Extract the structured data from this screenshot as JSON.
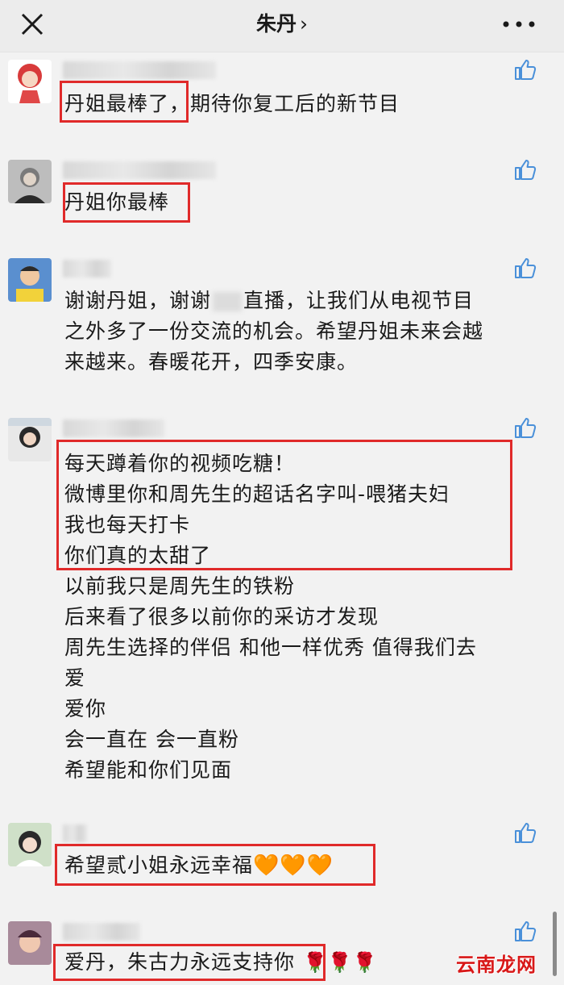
{
  "header": {
    "title": "朱丹",
    "chevron": "›",
    "close_icon": "close-icon",
    "more_icon": "more-icon"
  },
  "comments": [
    {
      "text": "丹姐最棒了，期待你复工后的新节目",
      "like_icon": "thumbs-up-icon"
    },
    {
      "text": "丹姐你最棒",
      "like_icon": "thumbs-up-icon"
    },
    {
      "line1_a": "谢谢丹姐，谢谢",
      "line1_b": "直播，让我们从电视节目",
      "line2": "之外多了一份交流的机会。希望丹姐未来会越",
      "line3": "来越来。春暖花开，四季安康。",
      "like_icon": "thumbs-up-icon"
    },
    {
      "lines": [
        "每天蹲着你的视频吃糖！",
        "微博里你和周先生的超话名字叫-喂猪夫妇",
        "我也每天打卡",
        "你们真的太甜了",
        "以前我只是周先生的铁粉",
        "后来看了很多以前你的采访才发现",
        "周先生选择的伴侣 和他一样优秀 值得我们去",
        "爱",
        "爱你",
        "会一直在 会一直粉",
        "希望能和你们见面"
      ],
      "like_icon": "thumbs-up-icon"
    },
    {
      "text": "希望贰小姐永远幸福",
      "emoji": "🧡🧡🧡",
      "like_icon": "thumbs-up-icon"
    },
    {
      "text": "爱丹，朱古力永远支持你",
      "emoji": "🌹🌹🌹",
      "like_icon": "thumbs-up-icon"
    }
  ],
  "watermark": "云南龙网",
  "colors": {
    "highlight": "#e02a2a",
    "background": "#f2f2f2",
    "like_icon": "#4a90d9"
  }
}
